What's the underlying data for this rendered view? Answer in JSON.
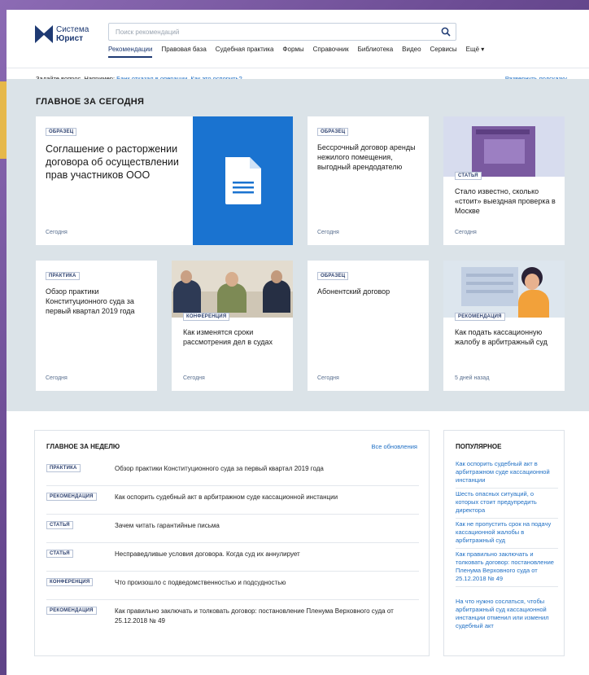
{
  "brand": {
    "line1": "Система",
    "line2": "Юрист"
  },
  "search": {
    "placeholder": "Поиск рекомендаций"
  },
  "nav": [
    "Рекомендации",
    "Правовая база",
    "Судебная практика",
    "Формы",
    "Справочник",
    "Библиотека",
    "Видео",
    "Сервисы",
    "Ещё ▾"
  ],
  "subbar": {
    "prompt": "Задайте вопрос. Например: ",
    "example": "Банк отказал в операции. Как это оспорить?",
    "expand": "Развернуть подсказку"
  },
  "today": {
    "title": "ГЛАВНОЕ ЗА СЕГОДНЯ",
    "cards": [
      {
        "badge": "ОБРАЗЕЦ",
        "title": "Соглашение о расторжении договора об осуществлении прав участников ООО",
        "date": "Сегодня"
      },
      {
        "badge": "ОБРАЗЕЦ",
        "title": "Бессрочный договор аренды нежилого помещения, выгодный арендодателю",
        "date": "Сегодня"
      },
      {
        "badge": "СТАТЬЯ",
        "title": "Стало известно, сколько «стоит» выездная проверка в Москве",
        "date": "Сегодня"
      },
      {
        "badge": "ПРАКТИКА",
        "title": "Обзор практики Конституционного суда за первый квартал 2019 года",
        "date": "Сегодня"
      },
      {
        "badge": "КОНФЕРЕНЦИЯ",
        "title": "Как изменятся сроки рассмотрения дел в судах",
        "date": "Сегодня"
      },
      {
        "badge": "ОБРАЗЕЦ",
        "title": "Абонентский договор",
        "date": "Сегодня"
      },
      {
        "badge": "РЕКОМЕНДАЦИЯ",
        "title": "Как подать кассационную жалобу в арбитражный суд",
        "date": "5 дней назад"
      }
    ]
  },
  "week": {
    "title": "ГЛАВНОЕ ЗА НЕДЕЛЮ",
    "all_link": "Все обновления",
    "items": [
      {
        "badge": "ПРАКТИКА",
        "text": "Обзор практики Конституционного суда за первый квартал 2019 года"
      },
      {
        "badge": "РЕКОМЕНДАЦИЯ",
        "text": "Как оспорить судебный акт в арбитражном суде кассационной инстанции"
      },
      {
        "badge": "СТАТЬЯ",
        "text": "Зачем читать гарантийные письма"
      },
      {
        "badge": "СТАТЬЯ",
        "text": "Несправедливые условия договора. Когда суд их аннулирует"
      },
      {
        "badge": "КОНФЕРЕНЦИЯ",
        "text": "Что произошло с подведомственностью и подсудностью"
      },
      {
        "badge": "РЕКОМЕНДАЦИЯ",
        "text": "Как правильно заключать и толковать договор: постановление Пленума Верховного суда от 25.12.2018 № 49"
      }
    ]
  },
  "popular": {
    "title": "ПОПУЛЯРНОЕ",
    "items": [
      "Как оспорить судебный акт в арбитражном суде кассационной инстанции",
      "Шесть опасных ситуаций, о которых стоит предупредить директора",
      "Как не пропустить срок на подачу кассационной жалобы в арбитражный суд",
      "Как правильно заключать и толковать договор: постановление Пленума Верховного суда от 25.12.2018 № 49",
      "На что нужно сослаться, чтобы арбитражный суд кассационной инстанции отменил или изменил судебный акт"
    ]
  },
  "colors": {
    "brand": "#1e3a73",
    "link": "#1f6fc4",
    "doc_panel": "#1a73d0",
    "section_bg": "#dbe3e8"
  },
  "icons": [
    "search-icon",
    "document-icon"
  ]
}
